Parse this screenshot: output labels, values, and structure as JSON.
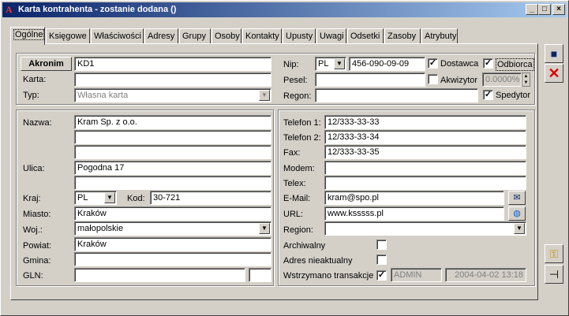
{
  "window": {
    "title": "Karta kontrahenta - zostanie dodana ()",
    "app_icon": "A"
  },
  "titlebar_buttons": {
    "minimize": "_",
    "maximize": "□",
    "close": "×"
  },
  "tabs": [
    "Ogólne",
    "Księgowe",
    "Właściwości",
    "Adresy",
    "Grupy",
    "Osoby",
    "Kontakty",
    "Upusty",
    "Uwagi",
    "Odsetki",
    "Zasoby",
    "Atrybuty"
  ],
  "top": {
    "akronim_button": "Akronim",
    "akronim_value": "KD1",
    "karta_label": "Karta:",
    "karta_value": "",
    "typ_label": "Typ:",
    "typ_value": "Własna karta",
    "nip_label": "Nip:",
    "nip_prefix": "PL",
    "nip_value": "456-090-09-09",
    "dostawca_label": "Dostawca",
    "dostawca_checked": "✓",
    "odbiorca_label": "Odbiorca",
    "odbiorca_checked": "✓",
    "pesel_label": "Pesel:",
    "pesel_value": "",
    "akwizytor_label": "Akwizytor",
    "akwizytor_value": "0.0000%",
    "regon_label": "Regon:",
    "regon_value": "",
    "spedytor_label": "Spedytor",
    "spedytor_checked": "✓"
  },
  "address": {
    "nazwa_label": "Nazwa:",
    "nazwa1": "Kram Sp. z o.o.",
    "nazwa2": "",
    "nazwa3": "",
    "ulica_label": "Ulica:",
    "ulica1": "Pogodna 17",
    "ulica2": "",
    "kraj_label": "Kraj:",
    "kraj_value": "PL",
    "kod_label": "Kod:",
    "kod_value": "30-721",
    "miasto_label": "Miasto:",
    "miasto_value": "Kraków",
    "woj_label": "Woj.:",
    "woj_value": "małopolskie",
    "powiat_label": "Powiat:",
    "powiat_value": "Kraków",
    "gmina_label": "Gmina:",
    "gmina_value": "",
    "gln_label": "GLN:",
    "gln_value": "",
    "gln_check": ""
  },
  "contact": {
    "tel1_label": "Telefon 1:",
    "tel1_value": "12/333-33-33",
    "tel2_label": "Telefon 2:",
    "tel2_value": "12/333-33-34",
    "fax_label": "Fax:",
    "fax_value": "12/333-33-35",
    "modem_label": "Modem:",
    "modem_value": "",
    "telex_label": "Telex:",
    "telex_value": "",
    "email_label": "E-Mail:",
    "email_value": "kram@spo.pl",
    "url_label": "URL:",
    "url_value": "www.ksssss.pl",
    "region_label": "Region:",
    "region_value": "",
    "archiwalny_label": "Archiwalny",
    "adres_label": "Adres nieaktualny",
    "wstrzymano_label": "Wstrzymano transakcje",
    "wstrzymano_checked": "✓",
    "operator_value": "ADMIN",
    "date_value": "2004-04-02 13:18"
  }
}
